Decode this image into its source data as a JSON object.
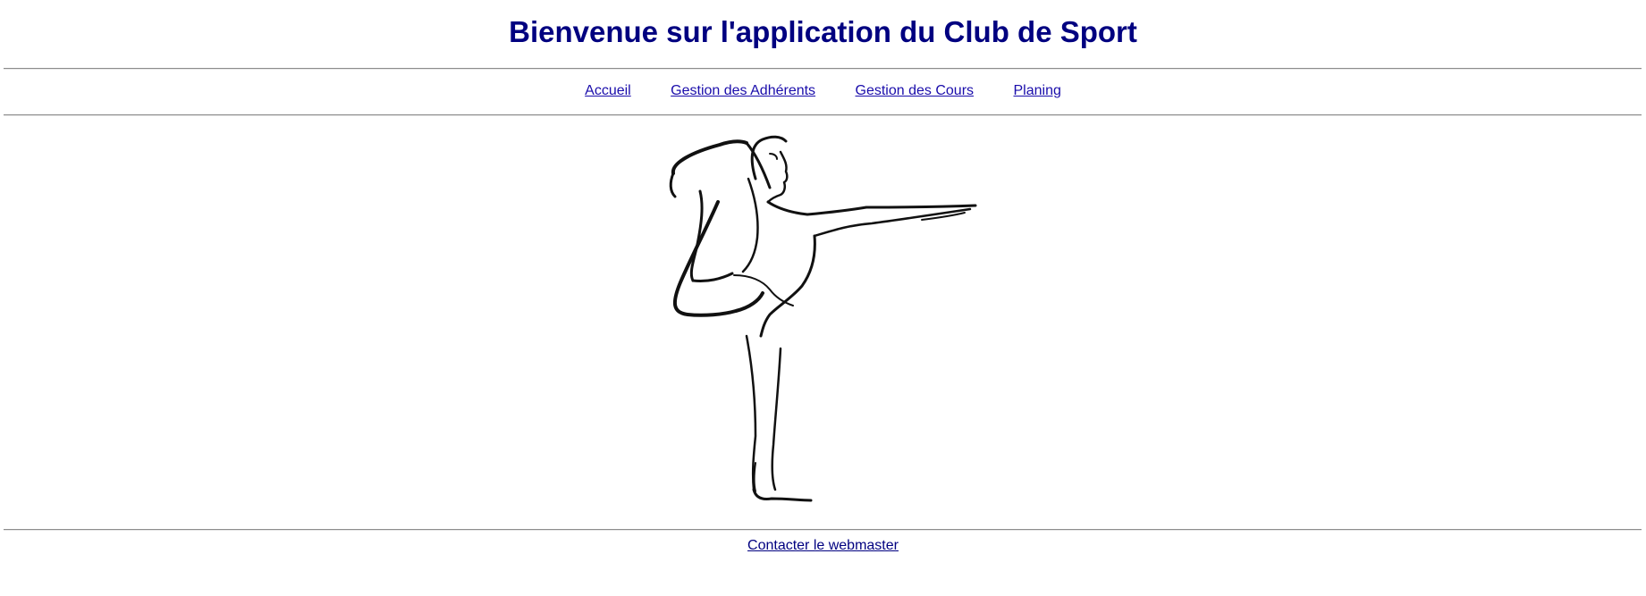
{
  "header": {
    "title": "Bienvenue sur l'application du Club de Sport"
  },
  "nav": {
    "items": [
      {
        "label": "Accueil"
      },
      {
        "label": "Gestion des Adhérents"
      },
      {
        "label": "Gestion des Cours"
      },
      {
        "label": "Planing"
      }
    ]
  },
  "main": {
    "illustration": "yoga-dancer-pose-line-drawing"
  },
  "footer": {
    "contact_label": "Contacter le webmaster"
  },
  "colors": {
    "title": "#000080",
    "nav_link": "#1a0dab",
    "footer_link": "#000080",
    "rule": "#8c8c8c"
  }
}
